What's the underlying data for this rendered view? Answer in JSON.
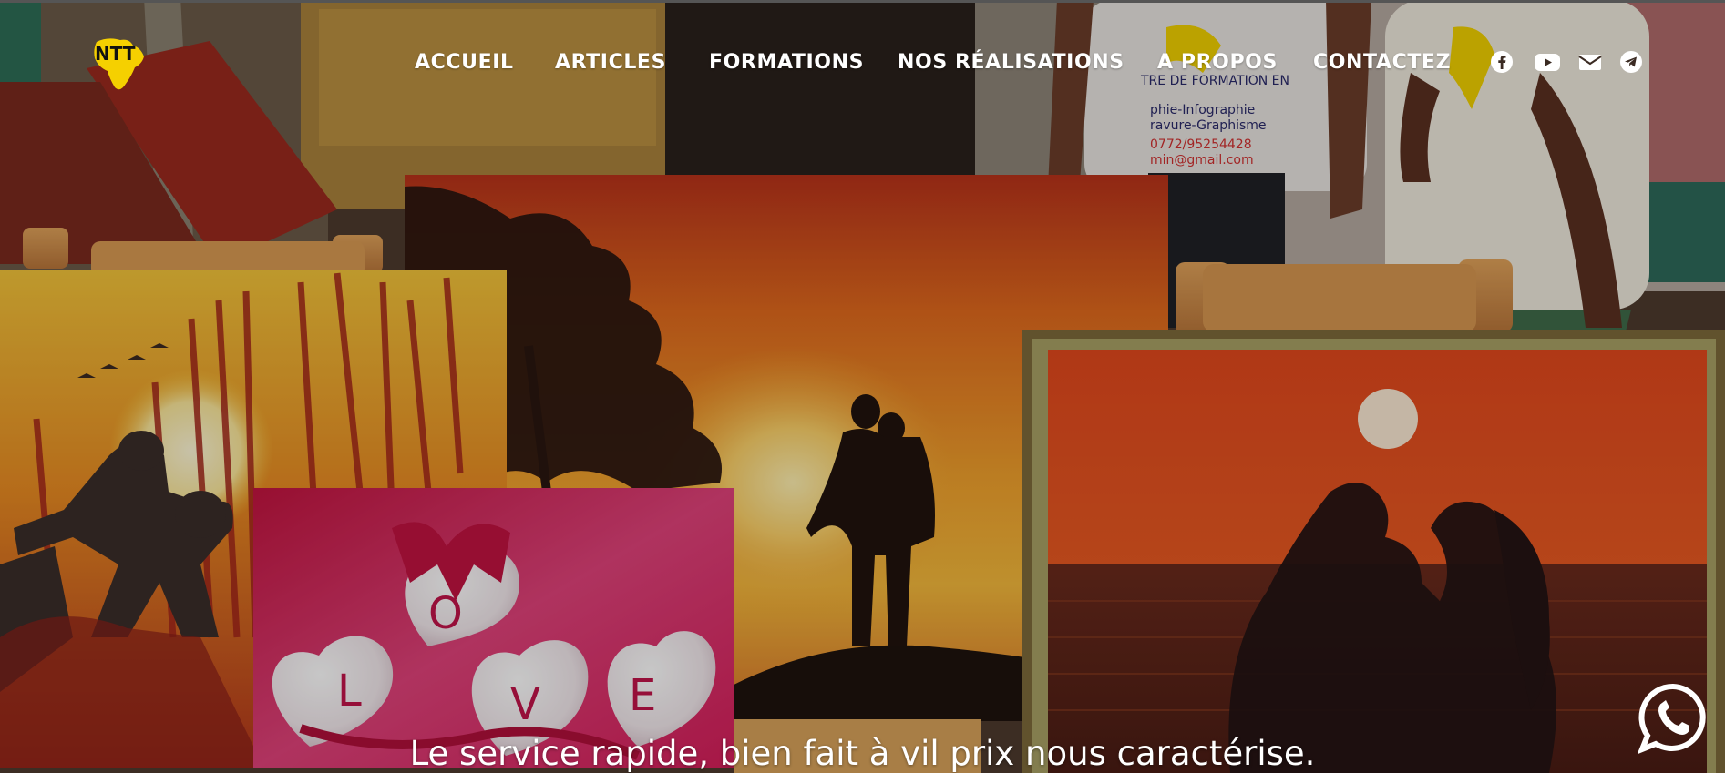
{
  "brand": {
    "logo_text": "NTT",
    "accent": "#f5d000"
  },
  "nav": {
    "items": [
      {
        "label": "ACCUEIL"
      },
      {
        "label": "ARTICLES"
      },
      {
        "label": "FORMATIONS"
      },
      {
        "label": "NOS RÉALISATIONS"
      },
      {
        "label": "A PROPOS"
      },
      {
        "label": "CONTACTEZ"
      }
    ]
  },
  "social": [
    {
      "icon": "facebook-icon"
    },
    {
      "icon": "youtube-icon"
    },
    {
      "icon": "email-icon"
    },
    {
      "icon": "telegram-icon"
    }
  ],
  "hero": {
    "tagline": "Le service rapide, bien fait à vil prix nous caractérise.",
    "love_letters": [
      "L",
      "O",
      "V",
      "E"
    ],
    "shirt_text": [
      "TRE DE FORMATION EN",
      "phie-Infographie",
      "ravure-Graphisme",
      "0772/95254428",
      "min@gmail.com"
    ]
  },
  "whatsapp": {
    "icon": "whatsapp-icon",
    "color": "#ffffff"
  }
}
